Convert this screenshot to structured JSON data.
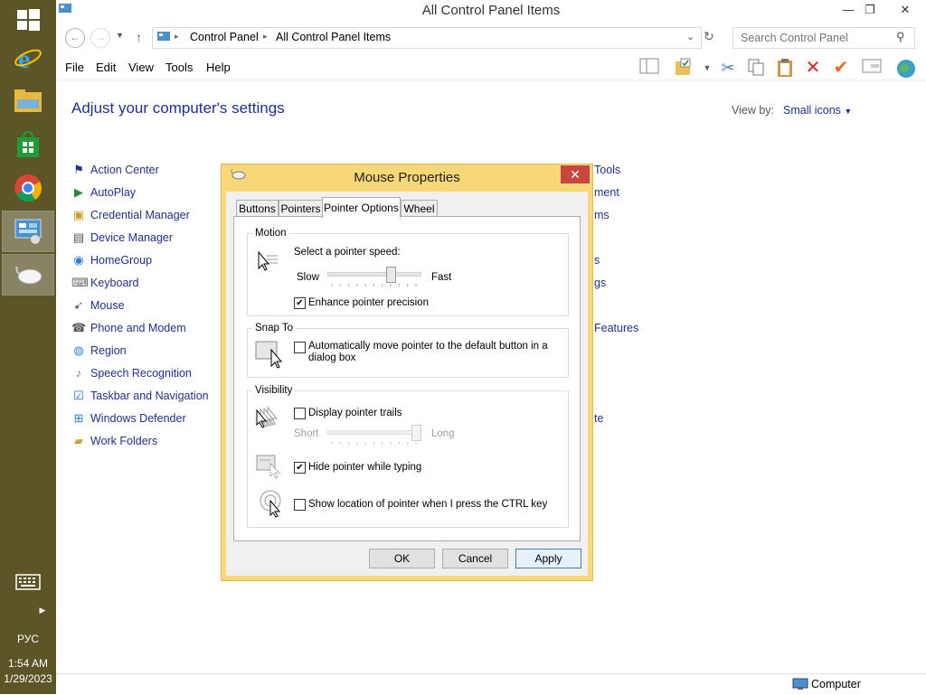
{
  "taskbar": {
    "lang": "РУС",
    "time": "1:54 AM",
    "date": "1/29/2023",
    "icons": [
      "start-icon",
      "ie-icon",
      "explorer-icon",
      "store-icon",
      "chrome-icon",
      "control-panel-icon",
      "mouse-icon",
      "keyboard-icon",
      "chevron-right-icon"
    ]
  },
  "window": {
    "title": "All Control Panel Items",
    "breadcrumb": [
      "Control Panel",
      "All Control Panel Items"
    ],
    "search_placeholder": "Search Control Panel",
    "menus": [
      "File",
      "Edit",
      "View",
      "Tools",
      "Help"
    ],
    "heading": "Adjust your computer's settings",
    "view_by_label": "View by:",
    "view_by_value": "Small icons",
    "status": "Computer"
  },
  "items_left": [
    {
      "label": "Action Center",
      "icon": "flag-icon"
    },
    {
      "label": "AutoPlay",
      "icon": "autoplay-icon"
    },
    {
      "label": "Credential Manager",
      "icon": "vault-icon"
    },
    {
      "label": "Device Manager",
      "icon": "device-icon"
    },
    {
      "label": "HomeGroup",
      "icon": "homegroup-icon"
    },
    {
      "label": "Keyboard",
      "icon": "keyboard-icon"
    },
    {
      "label": "Mouse",
      "icon": "mouse-icon"
    },
    {
      "label": "Phone and Modem",
      "icon": "phone-icon"
    },
    {
      "label": "Region",
      "icon": "globe-icon"
    },
    {
      "label": "Speech Recognition",
      "icon": "microphone-icon"
    },
    {
      "label": "Taskbar and Navigation",
      "icon": "taskbar-icon"
    },
    {
      "label": "Windows Defender",
      "icon": "shield-icon"
    },
    {
      "label": "Work Folders",
      "icon": "folder-icon"
    }
  ],
  "items_right_partial": [
    "Tools",
    "ment",
    "ms",
    "s",
    "gs",
    "Features",
    "te"
  ],
  "dialog": {
    "title": "Mouse Properties",
    "tabs": [
      "Buttons",
      "Pointers",
      "Pointer Options",
      "Wheel"
    ],
    "selected_tab": "Pointer Options",
    "motion": {
      "group_label": "Motion",
      "speed_label": "Select a pointer speed:",
      "slow": "Slow",
      "fast": "Fast",
      "speed_value": 0.7,
      "enhance_label": "Enhance pointer precision",
      "enhance_checked": true
    },
    "snap": {
      "group_label": "Snap To",
      "label_line1": "Automatically move pointer to the default button in a",
      "label_line2": "dialog box",
      "checked": false
    },
    "visibility": {
      "group_label": "Visibility",
      "trails_label": "Display pointer trails",
      "trails_checked": false,
      "short": "Short",
      "long": "Long",
      "trails_value": 1.0,
      "hide_label": "Hide pointer while typing",
      "hide_checked": true,
      "ctrl_label": "Show location of pointer when I press the CTRL key",
      "ctrl_checked": false
    },
    "buttons": {
      "ok": "OK",
      "cancel": "Cancel",
      "apply": "Apply"
    }
  }
}
